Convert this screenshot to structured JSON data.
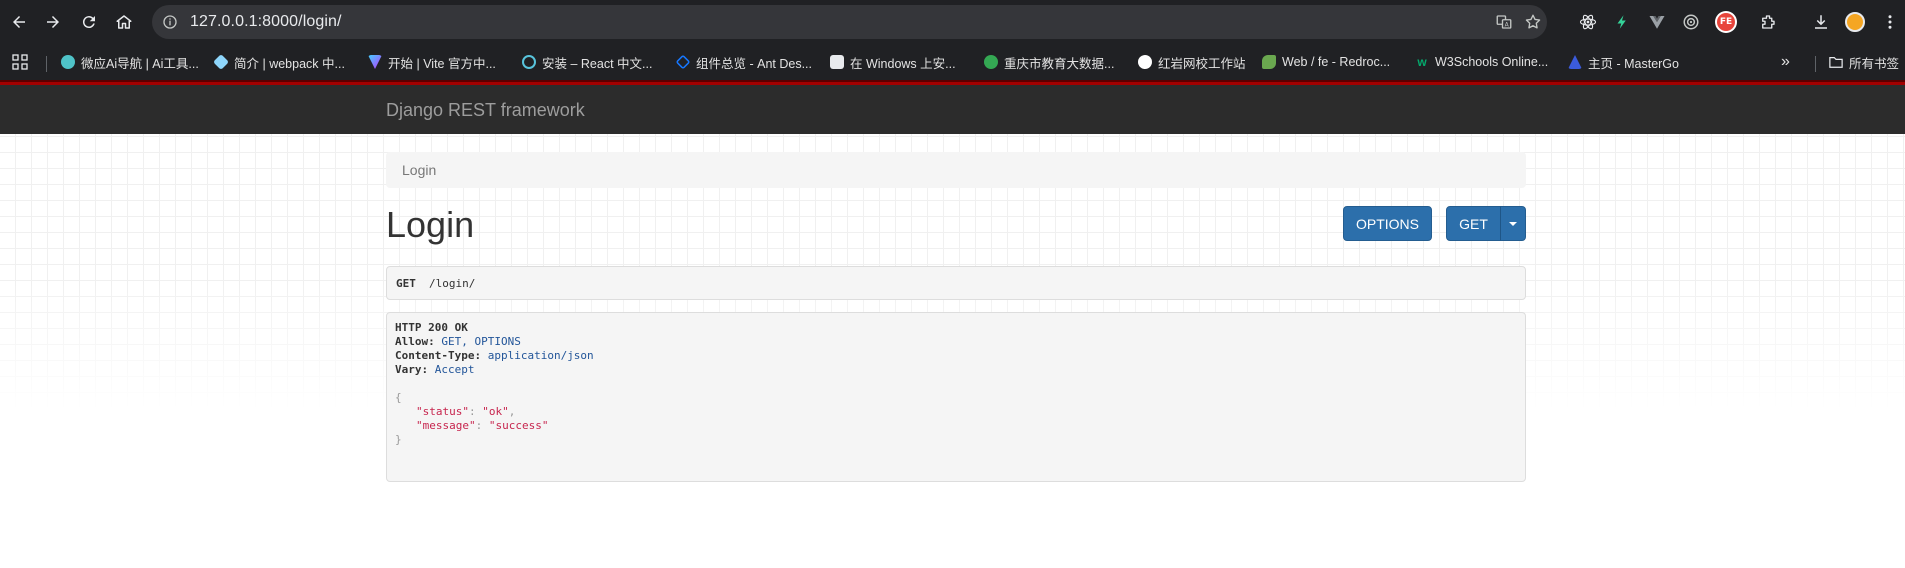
{
  "browser": {
    "url": "127.0.0.1:8000/login/",
    "bookmarks": [
      {
        "label": "微应Ai导航 | Ai工具...",
        "color": "#4fc3c8"
      },
      {
        "label": "简介 | webpack 中...",
        "color": "#8ed6fb"
      },
      {
        "label": "开始 | Vite 官方中...",
        "color": "#bd34fe"
      },
      {
        "label": "安装 – React 中文...",
        "color": "#58c4dc"
      },
      {
        "label": "组件总览 - Ant Des...",
        "color": "#1677ff"
      },
      {
        "label": "在 Windows 上安...",
        "color": "#e8eaed"
      },
      {
        "label": "重庆市教育大数据...",
        "color": "#34a853"
      },
      {
        "label": "红岩网校工作站",
        "color": "#ffffff"
      },
      {
        "label": "Web / fe - Redroc...",
        "color": "#6aa84f"
      },
      {
        "label": "W3Schools Online...",
        "color": "#04aa6d"
      },
      {
        "label": "主页 - MasterGo",
        "color": "#3b5bdb"
      }
    ],
    "all_bookmarks_label": "所有书签",
    "extension_badge": "FE"
  },
  "drf": {
    "brand": "Django REST framework",
    "breadcrumb": "Login",
    "title": "Login",
    "options_button": "OPTIONS",
    "get_button": "GET",
    "request": {
      "method": "GET",
      "path": "/login/"
    },
    "response": {
      "status_line": "HTTP 200 OK",
      "headers": [
        {
          "name": "Allow:",
          "value": "GET, OPTIONS"
        },
        {
          "name": "Content-Type:",
          "value": "application/json"
        },
        {
          "name": "Vary:",
          "value": "Accept"
        }
      ],
      "open_brace": "{",
      "close_brace": "}",
      "body": [
        {
          "key": "\"status\"",
          "value": "\"ok\"",
          "trail": ","
        },
        {
          "key": "\"message\"",
          "value": "\"success\"",
          "trail": ""
        }
      ]
    }
  }
}
